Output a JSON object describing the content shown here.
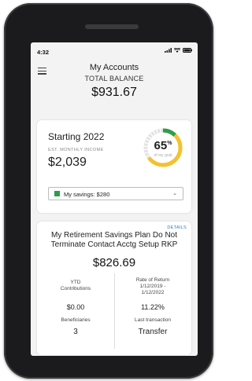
{
  "status": {
    "time": "4:32"
  },
  "header": {
    "title": "My Accounts",
    "subtitle": "TOTAL BALANCE",
    "balance": "$931.67"
  },
  "income_card": {
    "title": "Starting 2022",
    "est_label": "EST. MONTHLY INCOME",
    "amount": "$2,039",
    "gauge": {
      "percent": "65",
      "percent_sign": "%",
      "caption": "of my goal",
      "fraction": 0.65,
      "colors": {
        "progress": "#f4c130",
        "accent": "#2c9e4b",
        "track": "#e3e3e3"
      }
    },
    "dropdown": {
      "label": "My savings: $280",
      "swatch": "#2c9e4b"
    }
  },
  "plan_card": {
    "details_link": "DETAILS",
    "name": "My Retirement Savings Plan Do Not Terminate Contact Acctg Setup RKP",
    "balance": "$826.69",
    "ytd_label": "YTD Contributions",
    "ytd_value": "$0.00",
    "ror_label": "Rate of Return 1/12/2019 - 1/12/2022",
    "ror_value": "11.22%",
    "beneficiaries_label": "Beneficiaries",
    "beneficiaries_value": "3",
    "last_tx_label": "Last transaction",
    "last_tx_value": "Transfer"
  }
}
